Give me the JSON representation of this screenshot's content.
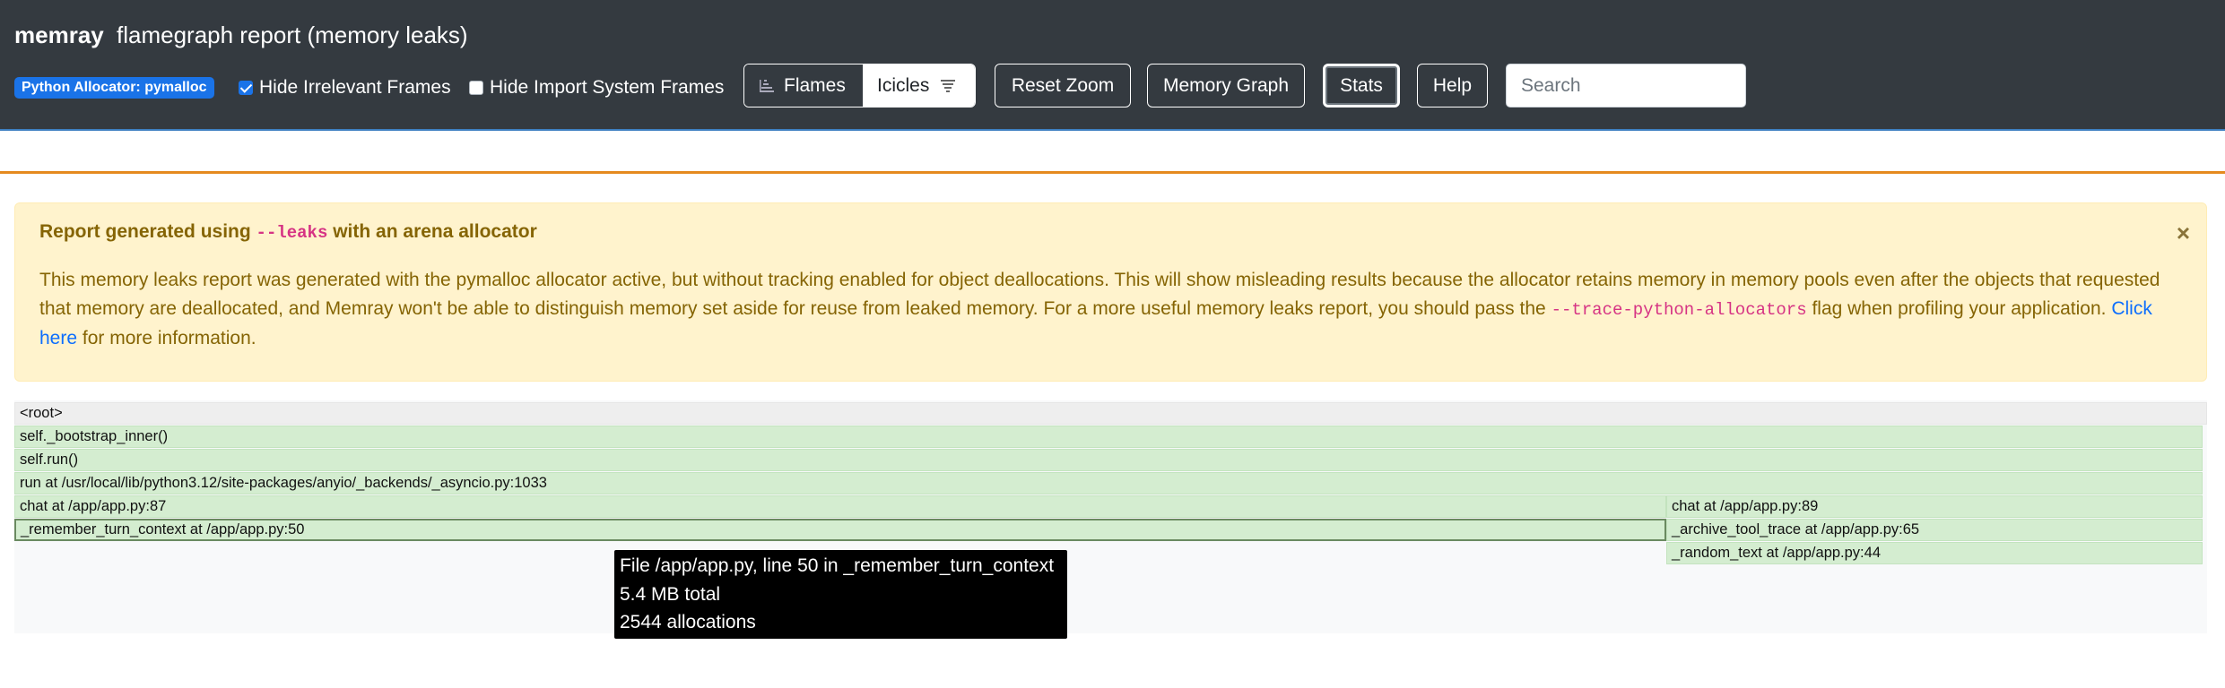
{
  "header": {
    "brand": "memray",
    "title": "flamegraph report (memory leaks)",
    "allocator_badge": "Python Allocator: pymalloc",
    "hide_irrelevant": {
      "label": "Hide Irrelevant Frames",
      "checked": true
    },
    "hide_import": {
      "label": "Hide Import System Frames",
      "checked": false
    },
    "view_toggle": {
      "flames_label": "Flames",
      "icicles_label": "Icicles",
      "selected": "Icicles"
    },
    "reset_zoom_label": "Reset Zoom",
    "memory_graph_label": "Memory Graph",
    "stats_label": "Stats",
    "help_label": "Help",
    "search_placeholder": "Search"
  },
  "alert": {
    "title_prefix": "Report generated using",
    "title_code": "--leaks",
    "title_suffix": "with an arena allocator",
    "body_part1": "This memory leaks report was generated with the pymalloc allocator active, but without tracking enabled for object deallocations. This will show misleading results because the allocator retains memory in memory pools even after the objects that requested that memory are deallocated, and Memray won't be able to distinguish memory set aside for reuse from leaked memory. For a more useful memory leaks report, you should pass the",
    "body_code": "--trace-python-allocators",
    "body_part2": "flag when profiling your application.",
    "link_text": "Click here",
    "body_part3": "for more information.",
    "close_symbol": "×"
  },
  "flamegraph": {
    "frames": [
      {
        "label": "<root>"
      },
      {
        "label": "self._bootstrap_inner()"
      },
      {
        "label": "self.run()"
      },
      {
        "label": "run at /usr/local/lib/python3.12/site-packages/anyio/_backends/_asyncio.py:1033"
      },
      {
        "label": "chat at /app/app.py:87"
      },
      {
        "label": "chat at /app/app.py:89"
      },
      {
        "label": "_remember_turn_context at /app/app.py:50"
      },
      {
        "label": "_archive_tool_trace at /app/app.py:65"
      },
      {
        "label": "_random_text at /app/app.py:44"
      }
    ]
  },
  "tooltip": {
    "line1": "File /app/app.py, line 50 in _remember_turn_context",
    "line2": "5.4 MB total",
    "line3": "2544 allocations"
  }
}
